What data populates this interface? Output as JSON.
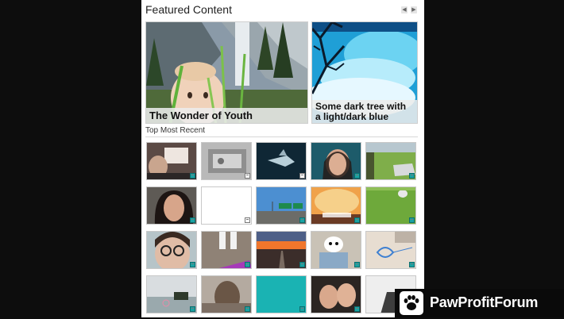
{
  "header": {
    "title": "Featured Content",
    "prev_icon": "chevron-left-icon",
    "next_icon": "chevron-right-icon",
    "prev_glyph": "◀",
    "next_glyph": "▶"
  },
  "featured": [
    {
      "caption": "The Wonder of Youth"
    },
    {
      "caption": "Some dark tree with a light/dark blue"
    }
  ],
  "recent": {
    "label": "Top Most Recent"
  },
  "colors": {
    "teal_thumb": "#1ab3b3",
    "sky_blue": "#27a6d9"
  },
  "watermark": {
    "text": "PawProfitForum",
    "logo_icon": "paw-print-icon"
  }
}
